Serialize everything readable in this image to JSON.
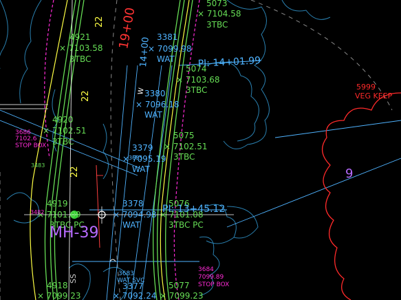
{
  "colors": {
    "background": "#000000",
    "survey_green": "#66dd55",
    "survey_blue": "#4fb3ff",
    "magenta": "#ff2bd6",
    "red": "#ff2a2a",
    "yellow": "#ffff44",
    "violet": "#b86bff",
    "white": "#ffffff",
    "tree_outline": "#2a80b0"
  },
  "labels": {
    "pt5073_id": "5073",
    "pt5073_elev": "× 7104.58",
    "pt5073_code": "3TBC",
    "pt4921_id": "4921",
    "pt4921_elev": "× 7103.58",
    "pt4921_code": "3TBC",
    "pt3381_id": "3381",
    "pt3381_elev": "× 7099.98",
    "pt3381_code": "WAT",
    "pt5074_id": "5074",
    "pt5074_elev": "× 7103.68",
    "pt5074_code": "3TBC",
    "pi_1401": "PI: 14+01.99",
    "pt3380_id": "3380",
    "pt3380_elev": "× 7096.18",
    "pt3380_code": "WAT",
    "pt5999_id": "5999",
    "pt5999_desc": "VEG KEEP",
    "pt4920_id": "4920",
    "pt4920_elev": "× 7102.51",
    "pt4920_code": "3TBC",
    "pt3686_id": "3686",
    "pt3686_elev": "7102.6",
    "pt3686_desc": "STOP BOX",
    "pt5075_id": "5075",
    "pt5075_elev": "× 7102.51",
    "pt5075_code": "3TBC",
    "pt3379_id": "3379",
    "pt3379_elev": "× 7095.19",
    "pt3379_code": "WAT",
    "pt3685": "3685",
    "pt3483": "3483",
    "station_22a": "22",
    "station_22b": "22",
    "station_22c": "22",
    "station_1900": "19+00",
    "station_1400": "14+00",
    "lot_number": "9",
    "pt4919_id": "4919",
    "pt4919_elev": "× 7101.09",
    "pt4919_code": "3TBC PC",
    "pt3378_id": "3378",
    "pt3378_elev": "× 7094.98",
    "pt3378_code": "WAT",
    "pt5076_id": "5076",
    "pt5076_elev": "× 7101.08",
    "pt5076_code": "3TBC PC",
    "pi_1345": "PI: 13+45.12",
    "pt3482": "3482",
    "mh_label": "MH-39",
    "pt3683_id": "3683",
    "pt3683_desc": "WAT SVC",
    "pt3684_id": "3684",
    "pt3684_elev": "7099.89",
    "pt3684_desc": "STOP BOX",
    "pt4918_id": "4918",
    "pt4918_elev": "× 7099.23",
    "pt3377_id": "3377",
    "pt3377_elev": "× 7092.24",
    "pt5077_id": "5077",
    "pt5077_elev": "× 7099.23",
    "ss_label": "SS",
    "w_marker": "W"
  }
}
